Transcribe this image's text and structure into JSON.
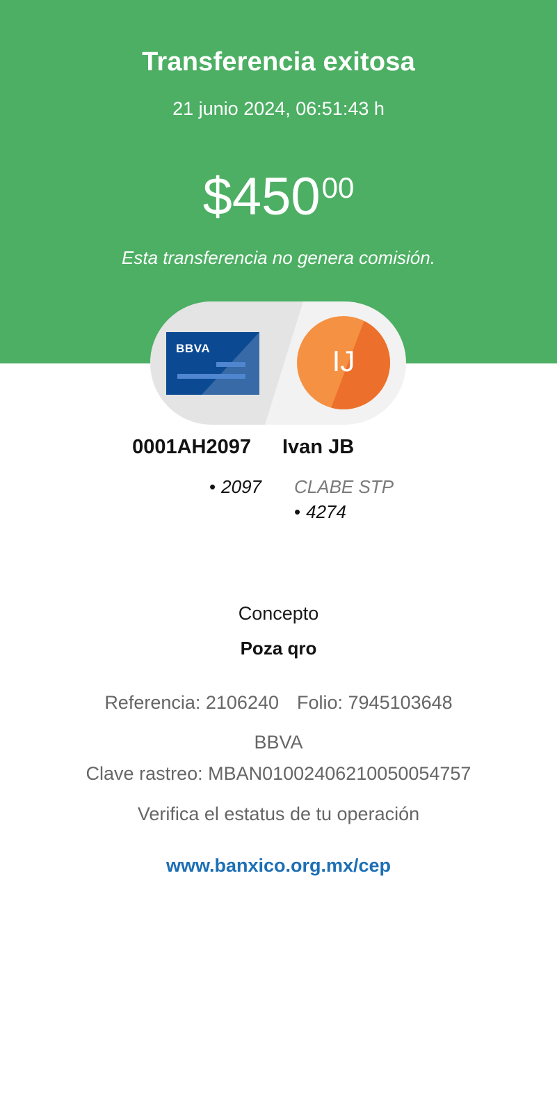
{
  "header": {
    "title": "Transferencia exitosa",
    "datetime": "21 junio 2024, 06:51:43 h",
    "amount_main": "$450",
    "amount_cents": "00",
    "fee_note": "Esta transferencia no genera comisión.",
    "background_color": "#4caf63"
  },
  "source": {
    "card_logo": "BBVA",
    "name": "0001AH2097",
    "digits": "2097",
    "card_color": "#0b4a93"
  },
  "destination": {
    "initials": "IJ",
    "name": "Ivan JB",
    "account_type": "CLABE STP",
    "digits": "4274",
    "avatar_color": "#f59142"
  },
  "details": {
    "concept_label": "Concepto",
    "concept_value": "Poza qro",
    "reference": "Referencia: 2106240",
    "folio": "Folio: 7945103648",
    "bank": "BBVA",
    "tracking_key": "Clave rastreo: MBAN01002406210050054757",
    "verify_text": "Verifica el estatus de tu operación",
    "verify_link": "www.banxico.org.mx/cep",
    "link_color": "#1d6fb5"
  }
}
